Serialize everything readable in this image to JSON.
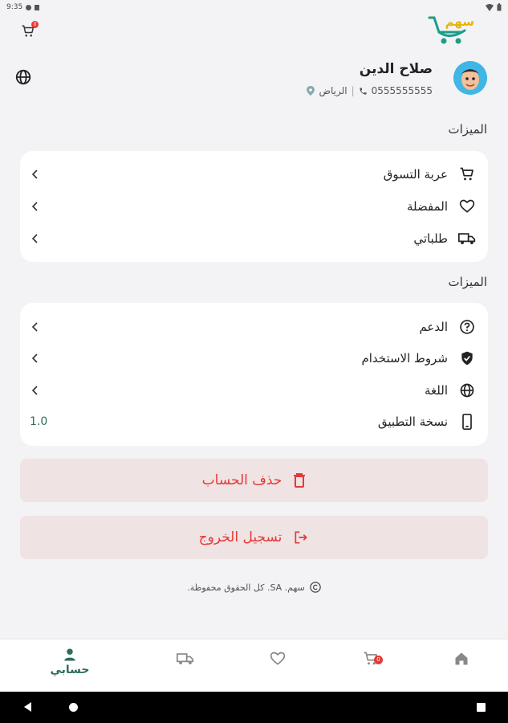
{
  "status_bar": {
    "time": "9:35"
  },
  "header": {
    "cart_badge": "0",
    "logo_text": "سهم"
  },
  "profile": {
    "name": "صلاح الدين",
    "city": "الرياض",
    "phone": "0555555555"
  },
  "sections": [
    {
      "title": "الميزات",
      "items": [
        {
          "label": "عربة التسوق",
          "icon": "cart-icon"
        },
        {
          "label": "المفضلة",
          "icon": "heart-icon"
        },
        {
          "label": "طلباتي",
          "icon": "truck-icon"
        }
      ]
    },
    {
      "title": "الميزات",
      "items": [
        {
          "label": "الدعم",
          "icon": "help-icon"
        },
        {
          "label": "شروط الاستخدام",
          "icon": "shield-check-icon"
        },
        {
          "label": "اللغة",
          "icon": "globe-icon"
        },
        {
          "label": "نسخة التطبيق",
          "icon": "phone-icon",
          "value": "1.0"
        }
      ]
    }
  ],
  "actions": {
    "delete_account": "حذف الحساب",
    "logout": "تسجيل الخروج"
  },
  "footer": {
    "copyright": "سهم. SA. كل الحقوق محفوظة."
  },
  "bottom_nav": {
    "account_label": "حسابي",
    "cart_badge": "0"
  },
  "colors": {
    "accent": "#2f6b5e",
    "danger": "#e53935",
    "danger_bg": "#efe3e4",
    "logo_green": "#1e9c8a",
    "logo_yellow": "#e8b400"
  }
}
